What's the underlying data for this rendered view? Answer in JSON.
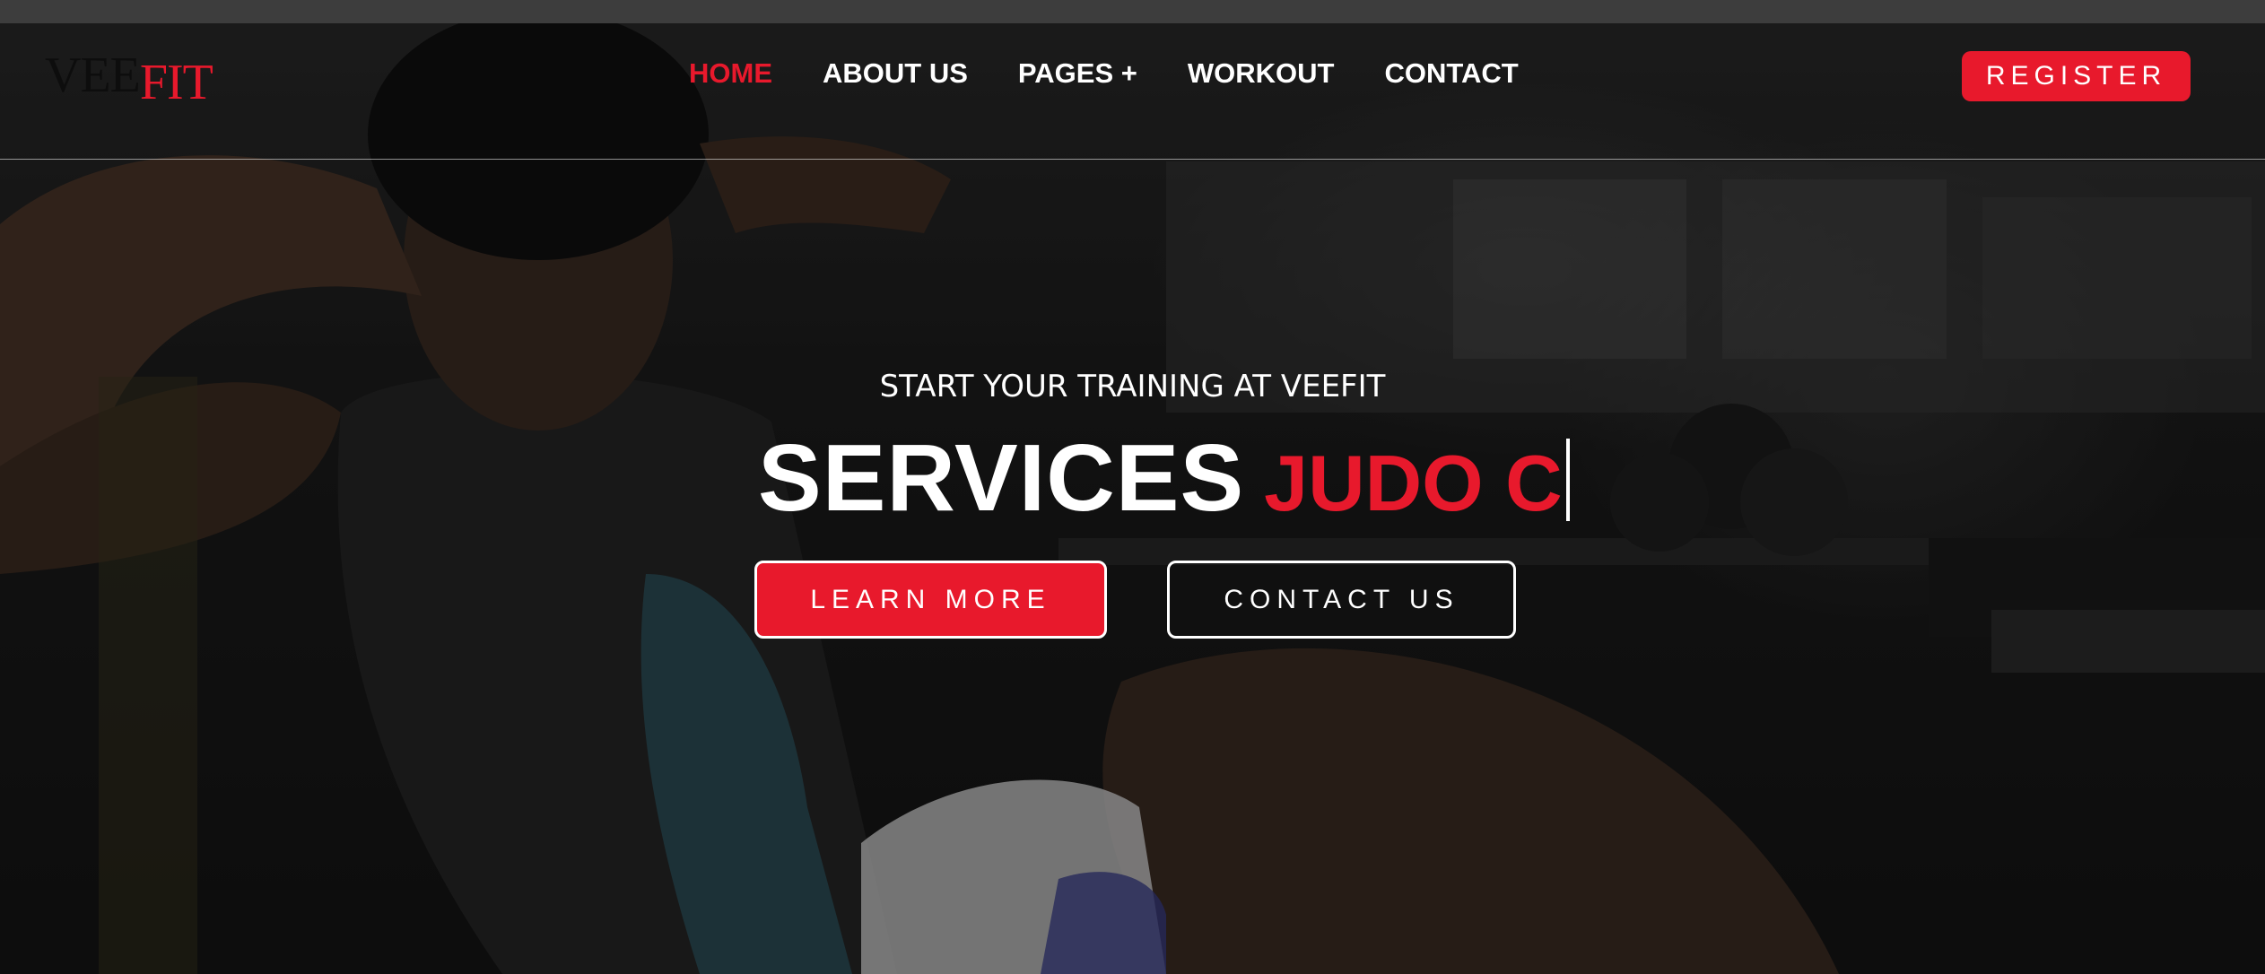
{
  "brand": {
    "logo_part_a": "VEE",
    "logo_part_b": "FIT",
    "accent_color": "#e8192c"
  },
  "nav": {
    "items": [
      {
        "label": "HOME",
        "active": true
      },
      {
        "label": "ABOUT US",
        "active": false
      },
      {
        "label": "PAGES +",
        "active": false
      },
      {
        "label": "WORKOUT",
        "active": false
      },
      {
        "label": "CONTACT",
        "active": false
      }
    ],
    "register_label": "REGISTER"
  },
  "hero": {
    "subtitle": "START YOUR TRAINING AT VEEFIT",
    "title_static": "SERVICES",
    "title_typed": "JUDO C",
    "primary_button": "LEARN MORE",
    "secondary_button": "CONTACT US"
  }
}
